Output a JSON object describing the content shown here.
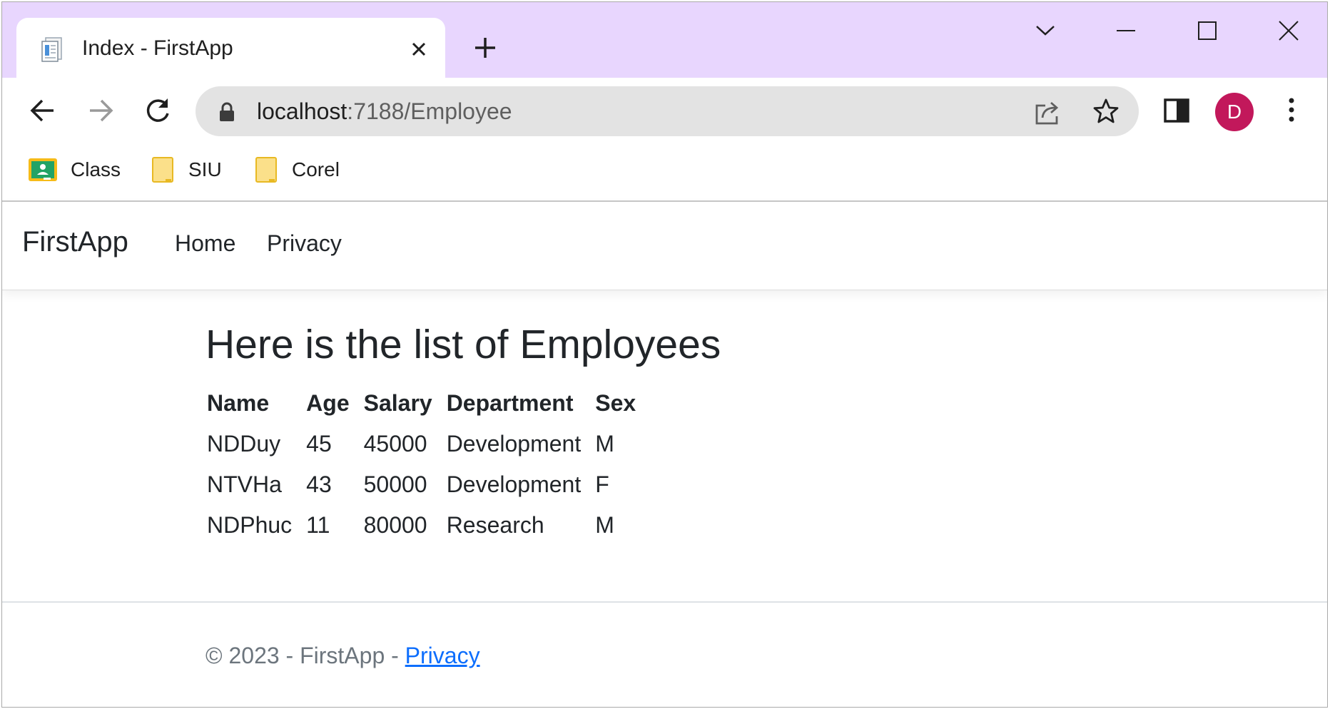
{
  "browser": {
    "tab_title": "Index - FirstApp",
    "url_host": "localhost",
    "url_rest": ":7188/Employee",
    "profile_initial": "D",
    "profile_color": "#c2185b",
    "tabstrip_color": "#e8d6fe",
    "bookmarks": [
      {
        "label": "Class",
        "icon": "google-classroom-icon"
      },
      {
        "label": "SIU",
        "icon": "folder-icon"
      },
      {
        "label": "Corel",
        "icon": "folder-icon"
      }
    ]
  },
  "site": {
    "brand": "FirstApp",
    "nav": [
      {
        "label": "Home"
      },
      {
        "label": "Privacy"
      }
    ]
  },
  "main": {
    "heading": "Here is the list of Employees",
    "table": {
      "columns": [
        "Name",
        "Age",
        "Salary",
        "Department",
        "Sex"
      ],
      "rows": [
        [
          "NDDuy",
          "45",
          "45000",
          "Development",
          "M"
        ],
        [
          "NTVHa",
          "43",
          "50000",
          "Development",
          "F"
        ],
        [
          "NDPhuc",
          "11",
          "80000",
          "Research",
          "M"
        ]
      ]
    }
  },
  "footer": {
    "text": "© 2023 - FirstApp - ",
    "link": "Privacy",
    "link_color": "#0d6efd"
  }
}
